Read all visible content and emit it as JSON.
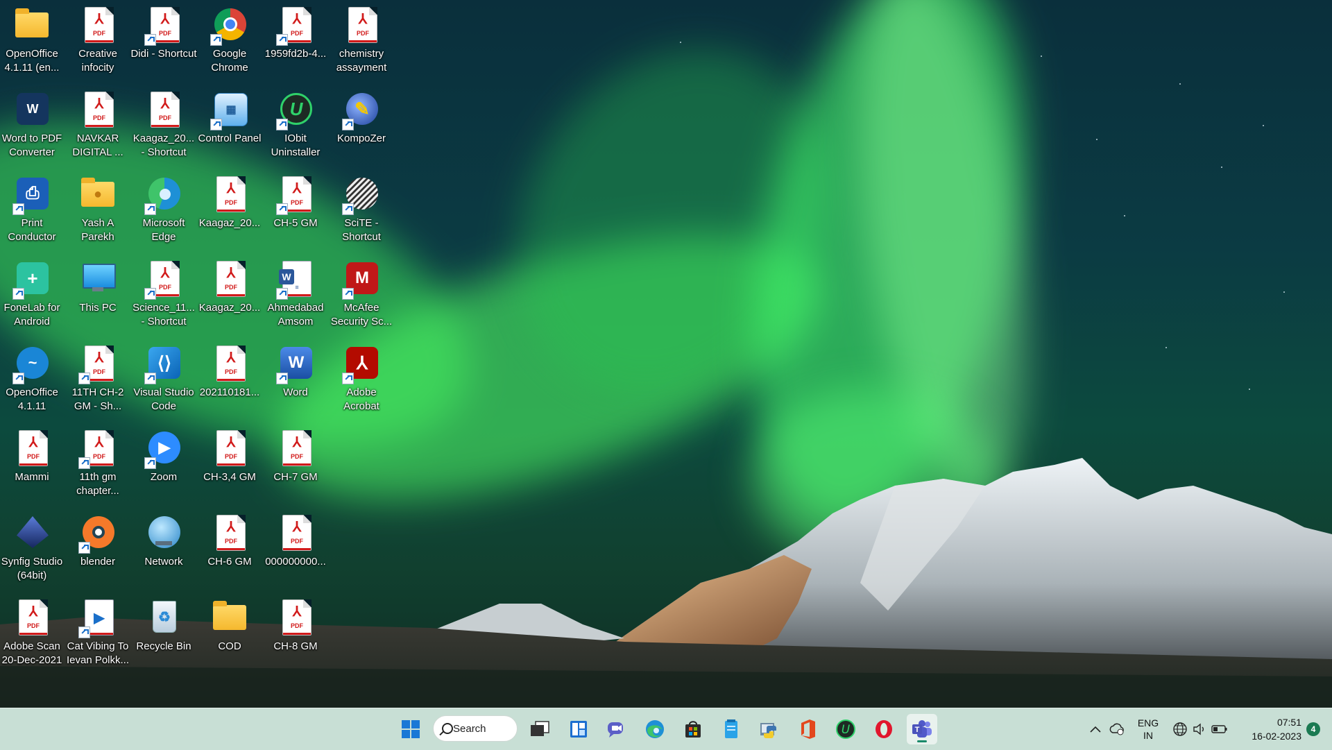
{
  "desktop": {
    "icons": [
      {
        "label": "OpenOffice 4.1.11 (en...",
        "icon": "folder-icon"
      },
      {
        "label": "Creative infocity",
        "icon": "pdf-file-icon"
      },
      {
        "label": "Didi - Shortcut",
        "icon": "pdf-file-icon"
      },
      {
        "label": "Google Chrome",
        "icon": "chrome-icon"
      },
      {
        "label": "1959fd2b-4...",
        "icon": "pdf-file-icon"
      },
      {
        "label": "chemistry assayment",
        "icon": "pdf-file-icon"
      },
      {
        "label": "Word to PDF Converter",
        "icon": "word-to-pdf-icon"
      },
      {
        "label": "NAVKAR DIGITAL ...",
        "icon": "pdf-file-icon"
      },
      {
        "label": "Kaagaz_20... - Shortcut",
        "icon": "pdf-file-icon"
      },
      {
        "label": "Control Panel",
        "icon": "control-panel-icon"
      },
      {
        "label": "IObit Uninstaller",
        "icon": "iobit-uninstaller-icon"
      },
      {
        "label": "KompoZer",
        "icon": "kompozer-icon"
      },
      {
        "label": "Print Conductor",
        "icon": "printer-icon"
      },
      {
        "label": "Yash A Parekh",
        "icon": "user-folder-icon"
      },
      {
        "label": "Microsoft Edge",
        "icon": "edge-icon"
      },
      {
        "label": "Kaagaz_20...",
        "icon": "pdf-file-icon"
      },
      {
        "label": "CH-5 GM",
        "icon": "pdf-file-icon"
      },
      {
        "label": "SciTE - Shortcut",
        "icon": "scite-icon"
      },
      {
        "label": "FoneLab for Android",
        "icon": "fonelab-icon"
      },
      {
        "label": "This PC",
        "icon": "monitor-icon"
      },
      {
        "label": "Science_11... - Shortcut",
        "icon": "pdf-file-icon"
      },
      {
        "label": "Kaagaz_20...",
        "icon": "pdf-file-icon"
      },
      {
        "label": "Ahmedabad Amsom",
        "icon": "word-document-icon"
      },
      {
        "label": "McAfee Security Sc...",
        "icon": "mcafee-icon"
      },
      {
        "label": "OpenOffice 4.1.11",
        "icon": "openoffice-icon"
      },
      {
        "label": "11TH CH-2 GM - Sh...",
        "icon": "pdf-file-icon"
      },
      {
        "label": "Visual Studio Code",
        "icon": "vscode-icon"
      },
      {
        "label": "202110181...",
        "icon": "pdf-file-icon"
      },
      {
        "label": "Word",
        "icon": "word-icon"
      },
      {
        "label": "Adobe Acrobat",
        "icon": "acrobat-icon"
      },
      {
        "label": "Mammi",
        "icon": "pdf-file-icon"
      },
      {
        "label": "11th gm chapter...",
        "icon": "pdf-file-icon"
      },
      {
        "label": "Zoom",
        "icon": "zoom-icon"
      },
      {
        "label": "CH-3,4 GM",
        "icon": "pdf-file-icon"
      },
      {
        "label": "CH-7 GM",
        "icon": "pdf-file-icon"
      },
      {
        "label": "Synfig Studio (64bit)",
        "icon": "synfig-icon"
      },
      {
        "label": "blender",
        "icon": "blender-icon"
      },
      {
        "label": "Network",
        "icon": "network-icon"
      },
      {
        "label": "CH-6 GM",
        "icon": "pdf-file-icon"
      },
      {
        "label": "000000000...",
        "icon": "pdf-file-icon"
      },
      {
        "label": "Adobe Scan 20-Dec-2021",
        "icon": "pdf-file-icon"
      },
      {
        "label": "Cat Vibing To Ievan Polkk...",
        "icon": "video-file-icon"
      },
      {
        "label": "Recycle Bin",
        "icon": "recycle-bin-icon"
      },
      {
        "label": "COD",
        "icon": "folder-icon"
      },
      {
        "label": "CH-8 GM",
        "icon": "pdf-file-icon"
      }
    ]
  },
  "taskbar": {
    "search_label": "Search",
    "pinned": [
      "start-icon",
      "task-view-icon",
      "widgets-icon",
      "chat-icon",
      "edge-icon",
      "store-icon",
      "notepad-icon",
      "python-icon",
      "office-icon",
      "iobit-icon",
      "opera-icon",
      "teams-icon"
    ],
    "tray": {
      "language_line1": "ENG",
      "language_line2": "IN",
      "time": "07:51",
      "date": "16-02-2023",
      "notification_count": "4"
    }
  }
}
